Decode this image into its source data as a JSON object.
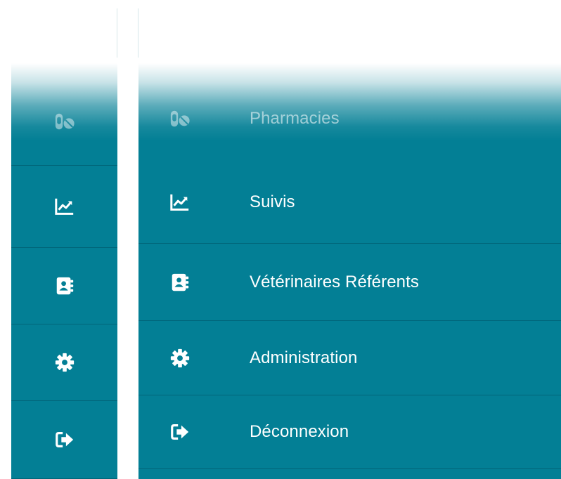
{
  "colors": {
    "sidebar_bg": "#037f95",
    "text": "#ffffff",
    "divider": "#005062"
  },
  "menu": {
    "items": [
      {
        "key": "pharmacies",
        "label": "Pharmacies",
        "icon": "pills-icon"
      },
      {
        "key": "suivis",
        "label": "Suivis",
        "icon": "chart-line-icon"
      },
      {
        "key": "veterinaires",
        "label": "Vétérinaires Référents",
        "icon": "address-book-icon"
      },
      {
        "key": "administration",
        "label": "Administration",
        "icon": "gear-icon"
      },
      {
        "key": "deconnexion",
        "label": "Déconnexion",
        "icon": "sign-out-icon"
      }
    ]
  }
}
